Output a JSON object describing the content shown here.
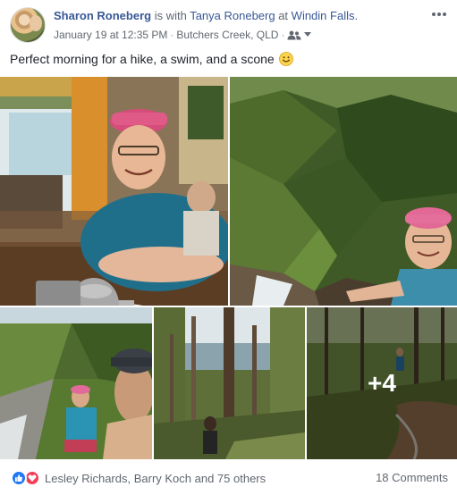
{
  "post": {
    "author": "Sharon Roneberg",
    "with_text": " is with ",
    "tagged": "Tanya Roneberg",
    "at_text": " at ",
    "place": "Windin Falls.",
    "date": "January 19 at 12:35 PM",
    "separator": "·",
    "location": "Butchers Creek, QLD",
    "audience_icon": "friends-icon",
    "message": "Perfect morning for a hike, a swim, and a scone",
    "message_emoji": "smile-icon",
    "more_options_icon": "ellipsis-icon"
  },
  "photos": {
    "count_overlay": "+4"
  },
  "footer": {
    "reactions": [
      "like-icon",
      "love-icon"
    ],
    "reactors": "Lesley Richards, Barry Koch and 75 others",
    "comments": "18 Comments"
  },
  "colors": {
    "link": "#385898",
    "like": "#2078f4",
    "love": "#f33e58",
    "meta": "#616770"
  }
}
